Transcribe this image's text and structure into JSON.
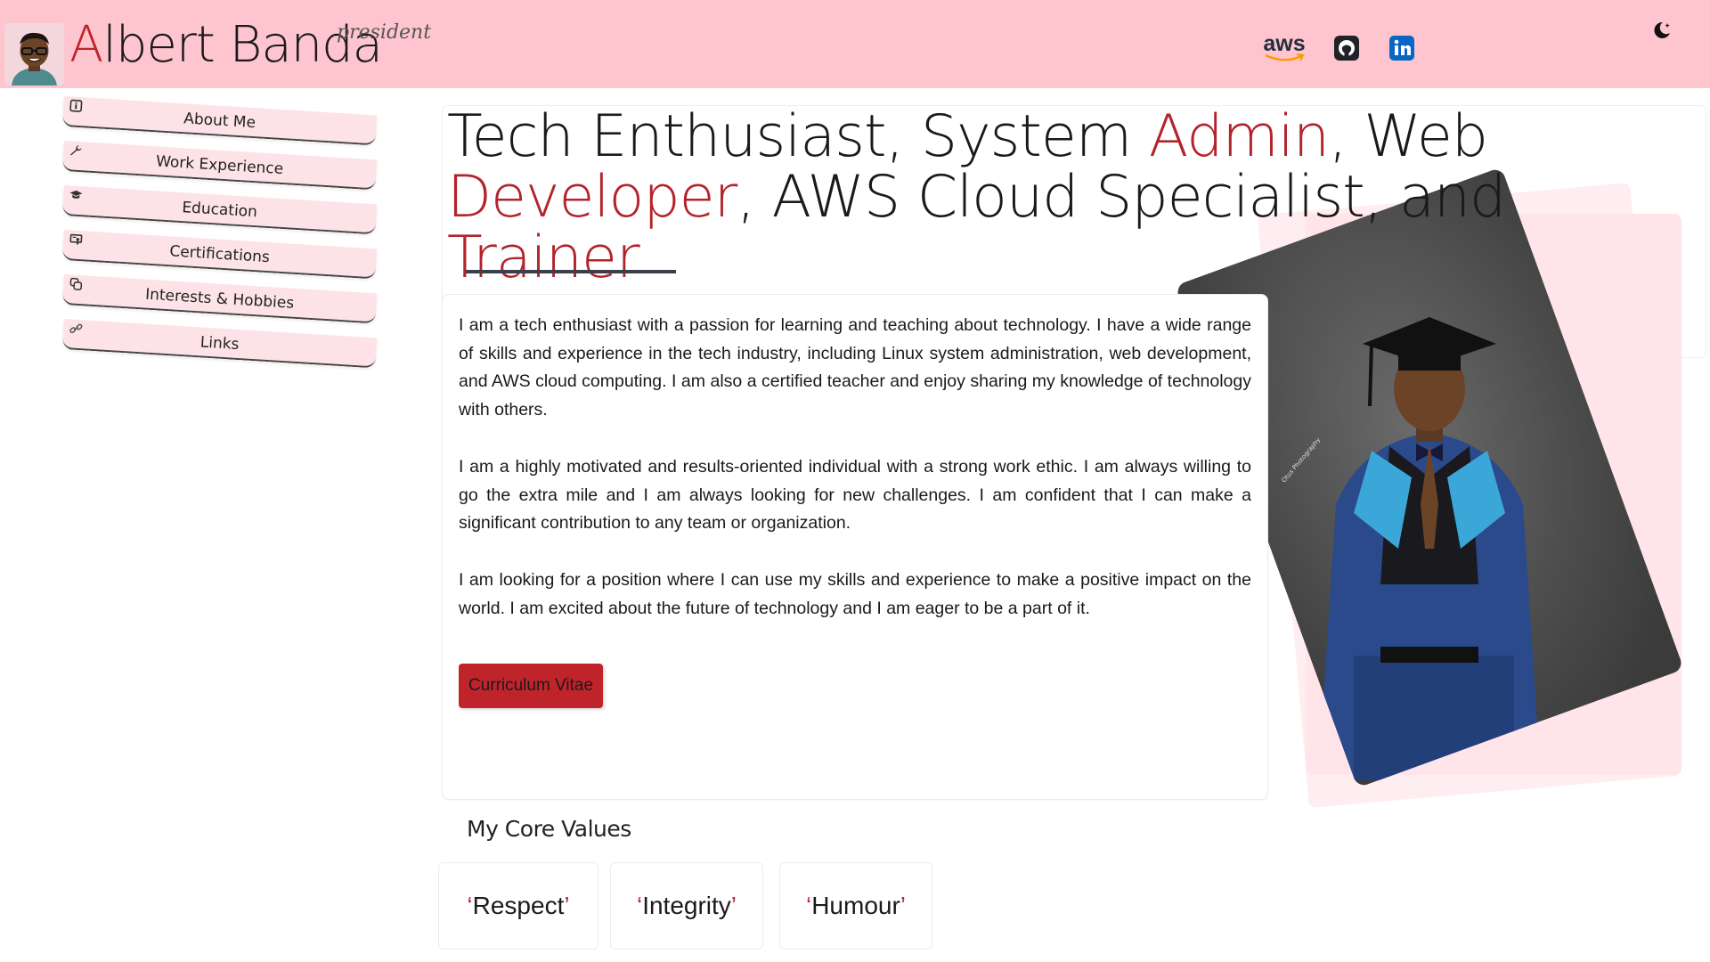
{
  "header": {
    "name_first_letter": "A",
    "name_rest": "lbert Banda",
    "role": "president",
    "social": [
      {
        "name": "aws-link",
        "label": "aws"
      },
      {
        "name": "github-link",
        "icon": "github-icon"
      },
      {
        "name": "linkedin-link",
        "icon": "linkedin-icon"
      }
    ],
    "theme_toggle_icon": "moon-icon"
  },
  "sidebar": {
    "items": [
      {
        "label": "About Me",
        "icon": "info-icon"
      },
      {
        "label": "Work Experience",
        "icon": "wrench-icon"
      },
      {
        "label": "Education",
        "icon": "graduation-cap-icon"
      },
      {
        "label": "Certifications",
        "icon": "certificate-icon"
      },
      {
        "label": "Interests & Hobbies",
        "icon": "hobbies-icon"
      },
      {
        "label": "Links",
        "icon": "link-icon"
      }
    ]
  },
  "hero": {
    "h1": "Tech Enthusiast, System ",
    "h2": "Admin",
    "h3": ", Web ",
    "h4": "Developer",
    "h5": ", AWS Cloud Specialist, and ",
    "h6": "Trainer"
  },
  "about": {
    "paragraphs": [
      "I am a tech enthusiast with a passion for learning and teaching about technology. I have a wide range of skills and experience in the tech industry, including Linux system administration, web development, and AWS cloud computing. I am also a certified teacher and enjoy sharing my knowledge of technology with others.",
      "I am a highly motivated and results-oriented individual with a strong work ethic. I am always willing to go the extra mile and I am always looking for new challenges. I am confident that I can make a significant contribution to any team or organization.",
      "I am looking for a position where I can use my skills and experience to make a positive impact on the world. I am excited about the future of technology and I am eager to be a part of it."
    ],
    "cv_button": "Curriculum Vitae"
  },
  "photo": {
    "watermark": "Otus Photography"
  },
  "core_values": {
    "title": "My Core Values",
    "items": [
      "Respect",
      "Integrity",
      "Humour"
    ]
  },
  "colors": {
    "header_bg": "#ffc5cf",
    "accent": "#c0242b",
    "nav_bg": "#fde3e7"
  }
}
